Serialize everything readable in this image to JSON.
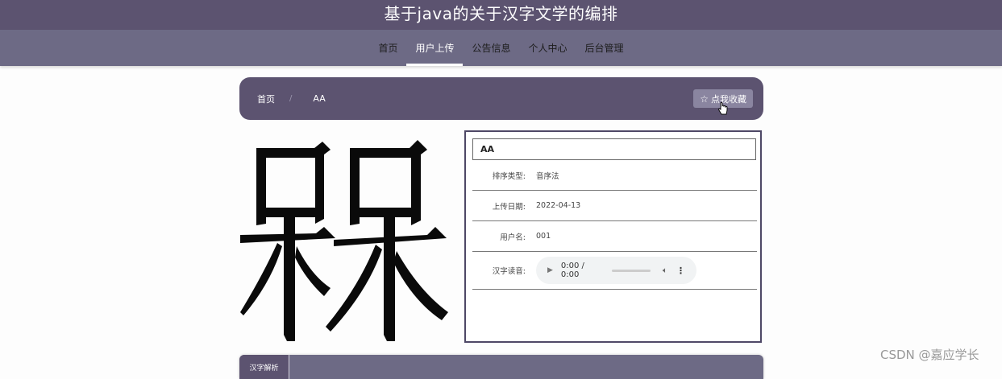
{
  "header": {
    "title": "基于java的关于汉字文学的编排"
  },
  "nav": {
    "items": [
      {
        "label": "首页"
      },
      {
        "label": "用户上传"
      },
      {
        "label": "公告信息"
      },
      {
        "label": "个人中心"
      },
      {
        "label": "后台管理"
      }
    ],
    "active": "用户上传"
  },
  "breadcrumb": {
    "home": "首页",
    "separator": "/",
    "current": "AA"
  },
  "favorite_button": {
    "label": "点我收藏",
    "icon": "star-outline-icon"
  },
  "detail": {
    "title": "AA",
    "rows": [
      {
        "label": "排序类型:",
        "value": "音序法"
      },
      {
        "label": "上传日期:",
        "value": "2022-04-13"
      },
      {
        "label": "用户名:",
        "value": "001"
      }
    ],
    "audio": {
      "label": "汉字读音:",
      "time": "0:00 / 0:00"
    }
  },
  "tabs": [
    {
      "label": "汉字解析"
    }
  ],
  "watermark": "CSDN @嘉应学长",
  "colors": {
    "primary": "#5c5370",
    "nav": "#6d6a85",
    "panel_border": "#4e4866"
  }
}
